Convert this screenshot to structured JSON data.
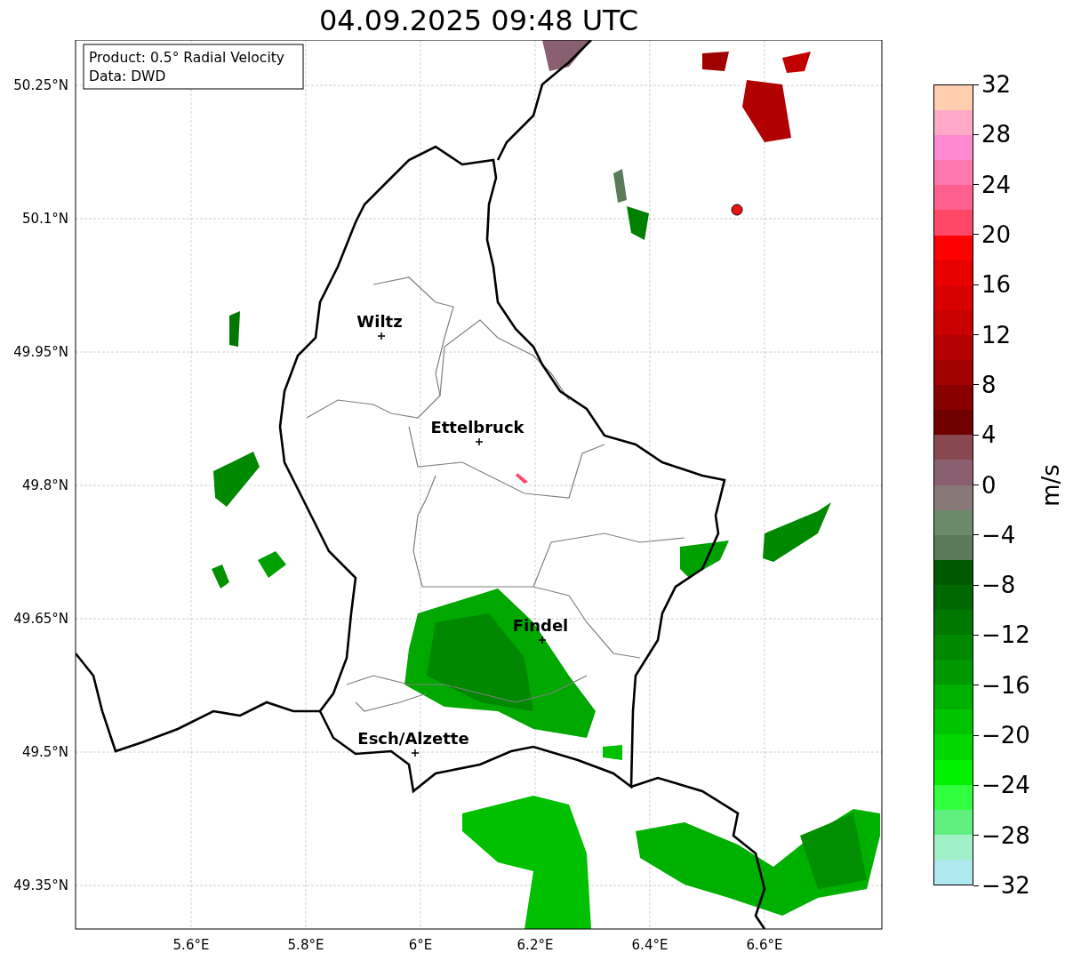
{
  "title": "04.09.2025 09:48 UTC",
  "legend": [
    "Product: 0.5° Radial Velocity",
    "Data: DWD"
  ],
  "map": {
    "lat_ticks": [
      "50.25°N",
      "50.1°N",
      "49.95°N",
      "49.8°N",
      "49.65°N",
      "49.5°N",
      "49.35°N"
    ],
    "lon_ticks": [
      "5.6°E",
      "5.8°E",
      "6°E",
      "6.2°E",
      "6.4°E",
      "6.6°E"
    ],
    "cities": [
      {
        "name": "Wiltz"
      },
      {
        "name": "Ettelbruck"
      },
      {
        "name": "Findel"
      },
      {
        "name": "Esch/Alzette"
      }
    ]
  },
  "colorbar": {
    "label": "m/s",
    "ticks": [
      "32",
      "28",
      "24",
      "20",
      "16",
      "12",
      "8",
      "4",
      "0",
      "−4",
      "−8",
      "−12",
      "−16",
      "−20",
      "−24",
      "−28",
      "−32"
    ],
    "bins": [
      {
        "color": "#ffcfb0"
      },
      {
        "color": "#ffa8c8"
      },
      {
        "color": "#ff88d0"
      },
      {
        "color": "#ff78b0"
      },
      {
        "color": "#ff6090"
      },
      {
        "color": "#ff4868"
      },
      {
        "color": "#ff0000"
      },
      {
        "color": "#e80000"
      },
      {
        "color": "#d80000"
      },
      {
        "color": "#c80000"
      },
      {
        "color": "#b40000"
      },
      {
        "color": "#a00000"
      },
      {
        "color": "#880000"
      },
      {
        "color": "#700000"
      },
      {
        "color": "#884850"
      },
      {
        "color": "#8a6070"
      },
      {
        "color": "#887878"
      },
      {
        "color": "#6a8a6a"
      },
      {
        "color": "#5a7a5a"
      },
      {
        "color": "#005800"
      },
      {
        "color": "#006800"
      },
      {
        "color": "#007800"
      },
      {
        "color": "#008800"
      },
      {
        "color": "#009800"
      },
      {
        "color": "#00b000"
      },
      {
        "color": "#00c400"
      },
      {
        "color": "#00d800"
      },
      {
        "color": "#00f000"
      },
      {
        "color": "#30ff40"
      },
      {
        "color": "#60f080"
      },
      {
        "color": "#a0f0c8"
      },
      {
        "color": "#b0e8f0"
      }
    ]
  }
}
